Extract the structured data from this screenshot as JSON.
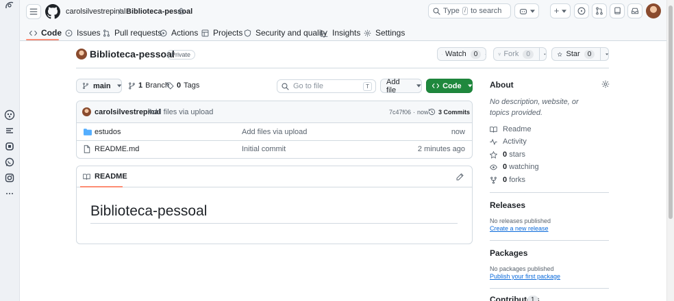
{
  "header": {
    "owner": "carolsilvestrepinal",
    "separator": "/",
    "repo": "Biblioteca-pessoal",
    "search_prefix": "Type",
    "search_key": "/",
    "search_suffix": "to search",
    "add_symbol": "+"
  },
  "tabs": [
    {
      "label": "Code",
      "icon": "code-icon",
      "active": true
    },
    {
      "label": "Issues",
      "icon": "issue-icon"
    },
    {
      "label": "Pull requests",
      "icon": "pull-request-icon"
    },
    {
      "label": "Actions",
      "icon": "play-icon"
    },
    {
      "label": "Projects",
      "icon": "table-icon"
    },
    {
      "label": "Security and quality",
      "icon": "shield-icon"
    },
    {
      "label": "Insights",
      "icon": "graph-icon"
    },
    {
      "label": "Settings",
      "icon": "gear-icon"
    }
  ],
  "repo_head": {
    "name": "Biblioteca-pessoal",
    "visibility": "Private",
    "watch_label": "Watch",
    "watch_count": "0",
    "fork_label": "Fork",
    "fork_count": "0",
    "star_label": "Star",
    "star_count": "0"
  },
  "toolbar": {
    "branch": "main",
    "branch_count": "1",
    "branch_label": "Branch",
    "tag_count": "0",
    "tag_label": "Tags",
    "goto_placeholder": "Go to file",
    "goto_key": "T",
    "add_file": "Add file",
    "code": "Code"
  },
  "commit": {
    "author": "carolsilvestrepinal",
    "message": "Add files via upload",
    "sha": "7c47f06",
    "sep": "·",
    "time": "now",
    "count_label": "3 Commits"
  },
  "files": [
    {
      "name": "estudos",
      "type": "folder",
      "message": "Add files via upload",
      "time": "now"
    },
    {
      "name": "README.md",
      "type": "file",
      "message": "Initial commit",
      "time": "2 minutes ago"
    }
  ],
  "readme": {
    "tab_label": "README",
    "heading": "Biblioteca-pessoal"
  },
  "about": {
    "title": "About",
    "description": "No description, website, or topics provided.",
    "readme": "Readme",
    "activity": "Activity",
    "stars_count": "0",
    "stars_label": "stars",
    "watching_count": "0",
    "watching_label": "watching",
    "forks_count": "0",
    "forks_label": "forks"
  },
  "releases": {
    "title": "Releases",
    "empty": "No releases published",
    "create_link": "Create a new release"
  },
  "packages": {
    "title": "Packages",
    "empty": "No packages published",
    "publish_link": "Publish your first package"
  },
  "contributors": {
    "title": "Contributors",
    "count": "1"
  },
  "colors": {
    "accent_green": "#1f883d",
    "link_blue": "#0969da",
    "active_tab_underline": "#fd8c73",
    "folder_blue": "#54aeff"
  }
}
